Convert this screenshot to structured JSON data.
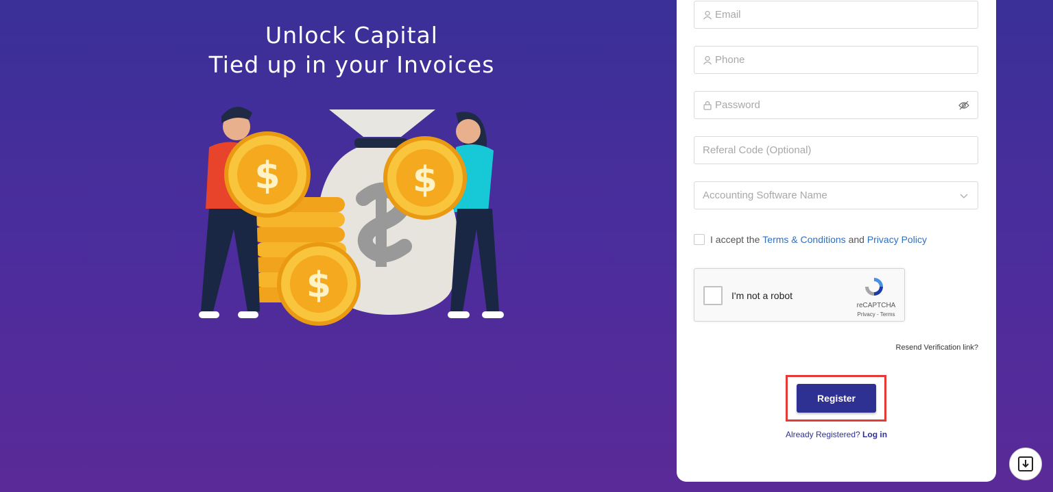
{
  "hero": {
    "title_line1": "Unlock Capital",
    "title_line2": "Tied up in your Invoices"
  },
  "form": {
    "email_placeholder": "Email",
    "phone_placeholder": "Phone",
    "password_placeholder": "Password",
    "referral_placeholder": "Referal Code (Optional)",
    "accounting_placeholder": "Accounting Software Name",
    "terms_prefix": "I accept the",
    "terms_link": "Terms & Conditions",
    "terms_and": "and",
    "privacy_link": "Privacy Policy",
    "recaptcha_label": "I'm not a robot",
    "recaptcha_brand": "reCAPTCHA",
    "recaptcha_links": "Privacy - Terms",
    "resend_link": "Resend Verification link?",
    "register_label": "Register",
    "already_text": "Already Registered?",
    "login_link": "Log in"
  },
  "icons": {
    "email": "user-icon",
    "phone": "user-icon",
    "password": "lock-icon",
    "password_toggle": "eye-slash-icon",
    "accounting": "chevron-down-icon",
    "download": "download-icon"
  },
  "colors": {
    "accent": "#2e3192",
    "link": "#2f6fc0",
    "highlight": "#e53935"
  }
}
